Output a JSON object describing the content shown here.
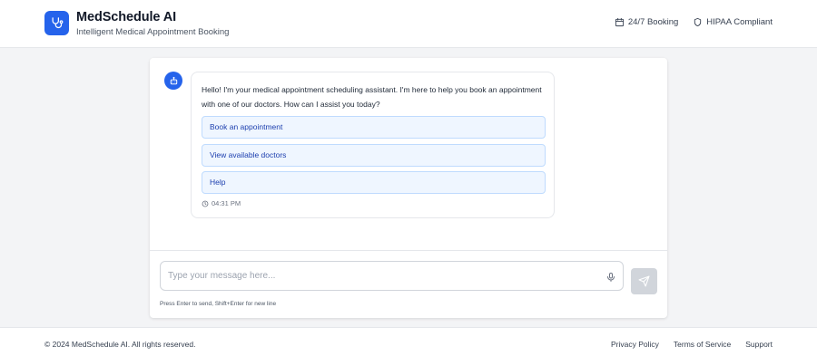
{
  "header": {
    "title": "MedSchedule AI",
    "subtitle": "Intelligent Medical Appointment Booking",
    "logo_icon": "stethoscope-icon",
    "badges": [
      {
        "label": "24/7 Booking",
        "icon": "calendar-icon"
      },
      {
        "label": "HIPAA Compliant",
        "icon": "shield-icon"
      }
    ]
  },
  "chat": {
    "bot_avatar_icon": "robot-icon",
    "message": {
      "text": "Hello! I'm your medical appointment scheduling assistant. I'm here to help you book an appointment with one of our doctors. How can I assist you today?",
      "time": "04:31 PM",
      "quick_replies": [
        "Book an appointment",
        "View available doctors",
        "Help"
      ]
    }
  },
  "input": {
    "placeholder": "Type your message here...",
    "value": "",
    "hint": "Press Enter to send, Shift+Enter for new line",
    "mic_icon": "microphone-icon",
    "send_icon": "send-icon"
  },
  "footer": {
    "copyright": "© 2024 MedSchedule AI. All rights reserved.",
    "links": [
      "Privacy Policy",
      "Terms of Service",
      "Support"
    ]
  },
  "colors": {
    "primary": "#2563eb",
    "background": "#f3f4f6",
    "quick_reply_bg": "#eff6ff",
    "quick_reply_border": "#bfdbfe",
    "quick_reply_text": "#1e40af",
    "send_disabled": "#d1d5db"
  }
}
